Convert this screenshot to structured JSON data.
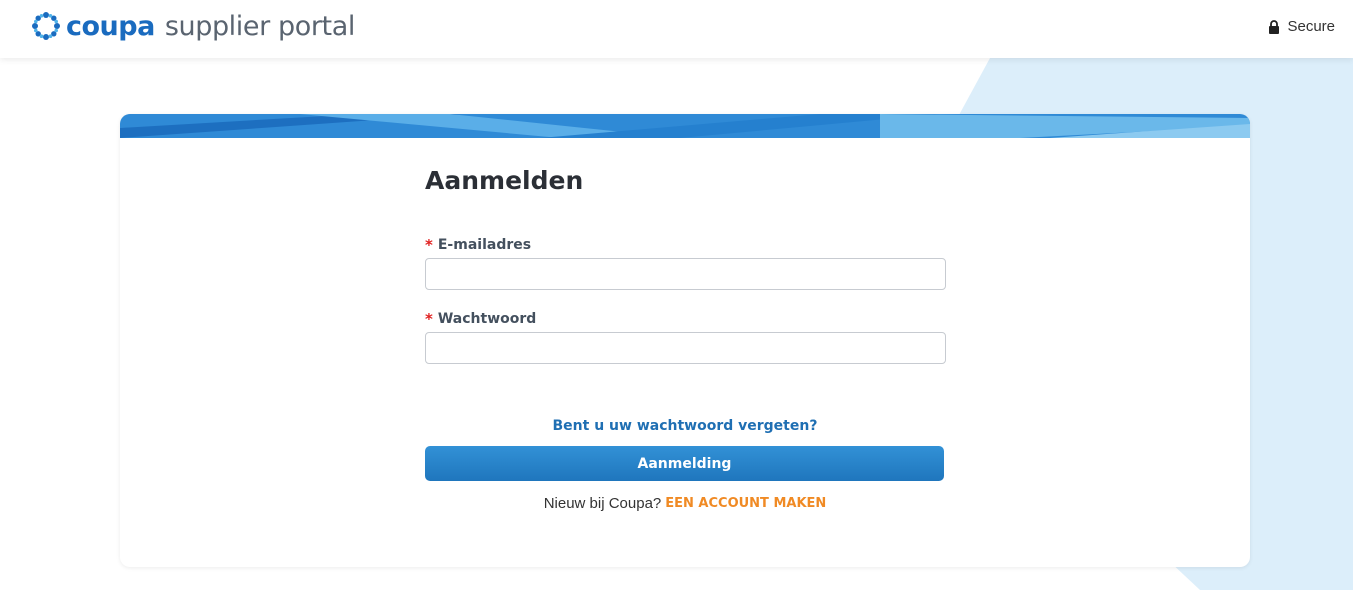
{
  "header": {
    "brand": "coupa",
    "subtitle": "supplier portal",
    "secure_label": "Secure"
  },
  "login": {
    "title": "Aanmelden",
    "required_marker": "*",
    "email_label": "E-mailadres",
    "email_value": "",
    "password_label": "Wachtwoord",
    "password_value": "",
    "forgot_link": "Bent u uw wachtwoord vergeten?",
    "submit_label": "Aanmelding",
    "new_prompt": "Nieuw bij Coupa?",
    "create_account_link": "EEN ACCOUNT MAKEN"
  },
  "colors": {
    "brand_blue": "#1a6bbf",
    "button_blue": "#2684cb",
    "link_blue": "#1f6fb3",
    "accent_orange": "#f08a24",
    "required_red": "#e02020",
    "background_shape": "#dceefa"
  },
  "icons": {
    "logo": "coupa-starburst-icon",
    "secure": "lock-icon"
  }
}
